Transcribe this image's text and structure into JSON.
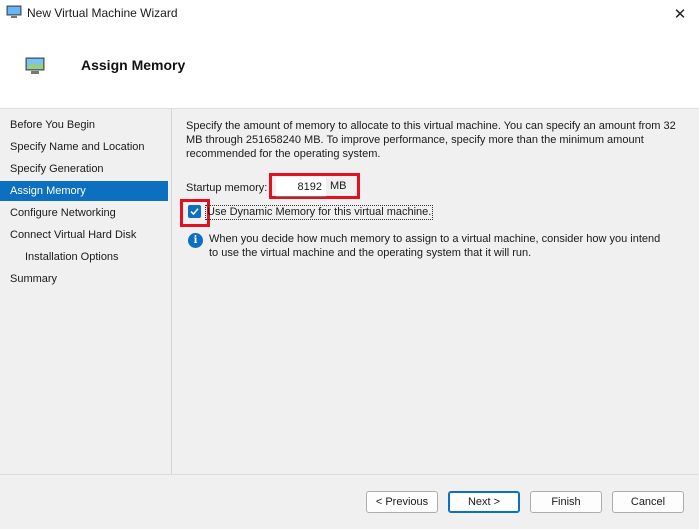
{
  "window": {
    "title": "New Virtual Machine Wizard",
    "close_glyph": "✕"
  },
  "header": {
    "title": "Assign Memory"
  },
  "nav": {
    "items": [
      {
        "label": "Before You Begin"
      },
      {
        "label": "Specify Name and Location"
      },
      {
        "label": "Specify Generation"
      },
      {
        "label": "Assign Memory"
      },
      {
        "label": "Configure Networking"
      },
      {
        "label": "Connect Virtual Hard Disk"
      },
      {
        "label": "Installation Options"
      },
      {
        "label": "Summary"
      }
    ],
    "active_index": 3
  },
  "content": {
    "description": "Specify the amount of memory to allocate to this virtual machine. You can specify an amount from 32 MB through 251658240 MB. To improve performance, specify more than the minimum amount recommended for the operating system.",
    "startup_label": "Startup memory:",
    "startup_value": "8192",
    "startup_unit": "MB",
    "dynamic_label": "Use Dynamic Memory for this virtual machine.",
    "dynamic_checked": true,
    "info_text": "When you decide how much memory to assign to a virtual machine, consider how you intend to use the virtual machine and the operating system that it will run.",
    "info_glyph": "i"
  },
  "footer": {
    "previous_label": "< Previous",
    "next_label": "Next >",
    "finish_label": "Finish",
    "cancel_label": "Cancel"
  },
  "colors": {
    "accent": "#0c6fc0",
    "highlight": "#e3101f"
  }
}
